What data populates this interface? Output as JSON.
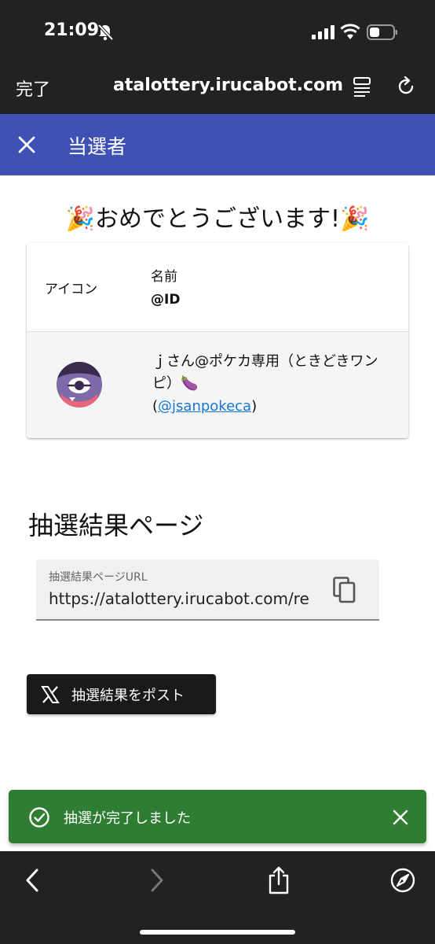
{
  "status_bar": {
    "time": "21:09"
  },
  "browser": {
    "done_label": "完了",
    "url": "atalottery.irucabot.com"
  },
  "appbar": {
    "title": "当選者"
  },
  "congrats": "🎉おめでとうございます!🎉",
  "table": {
    "header": {
      "icon_col": "アイコン",
      "name_col": "名前",
      "id_col": "@ID"
    },
    "winner": {
      "name": "ｊさん@ポケカ専用（ときどきワンピ）🍆",
      "id_prefix": "(",
      "id": "@jsanpokeca",
      "id_suffix": ")"
    }
  },
  "result_section": {
    "title": "抽選結果ページ",
    "field_label": "抽選結果ページURL",
    "field_value": "https://atalottery.irucabot.com/re"
  },
  "post_button": {
    "label": "抽選結果をポスト"
  },
  "snackbar": {
    "message": "抽選が完了しました"
  }
}
